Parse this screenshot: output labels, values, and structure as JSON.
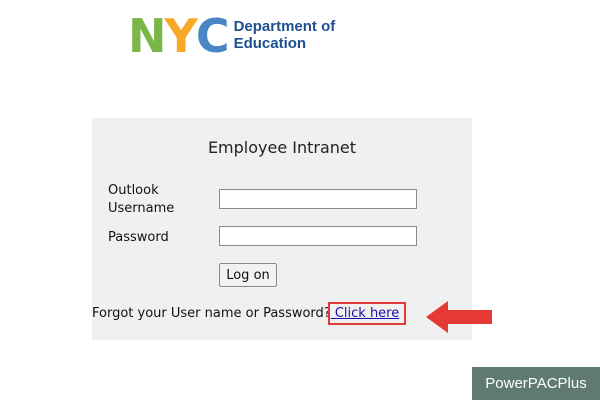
{
  "logo": {
    "letters": [
      "N",
      "Y",
      "C"
    ],
    "line1": "Department of",
    "line2": "Education",
    "colors": {
      "n": "#7ab648",
      "y": "#f9a825",
      "c": "#4a86c5",
      "text": "#1e4f8f"
    }
  },
  "panel": {
    "title": "Employee Intranet",
    "username_label": "Outlook\nUsername",
    "username_value": "",
    "password_label": "Password",
    "password_value": "",
    "logon_label": "Log on",
    "forgot_text": "Forgot your User name or Password?",
    "forgot_link": " Click here"
  },
  "annotation": {
    "arrow_icon": "left-arrow-icon",
    "color": "#e53935"
  },
  "watermark": {
    "text": "PowerPACPlus"
  }
}
